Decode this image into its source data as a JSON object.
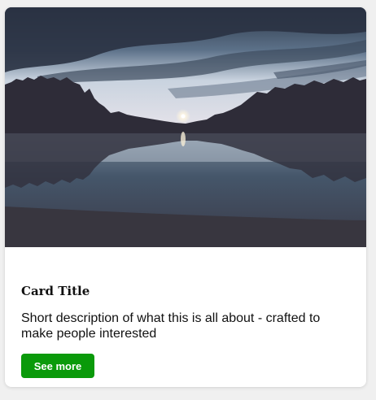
{
  "card": {
    "title": "Card Title",
    "description": "Short description of what this is all about - crafted to make people interested",
    "button_label": "See more",
    "image": "lake-sunset-landscape-photo"
  },
  "colors": {
    "button_background": "#0a9a0a",
    "button_text": "#ffffff",
    "card_background": "#ffffff",
    "page_background": "#f0f0f0"
  }
}
